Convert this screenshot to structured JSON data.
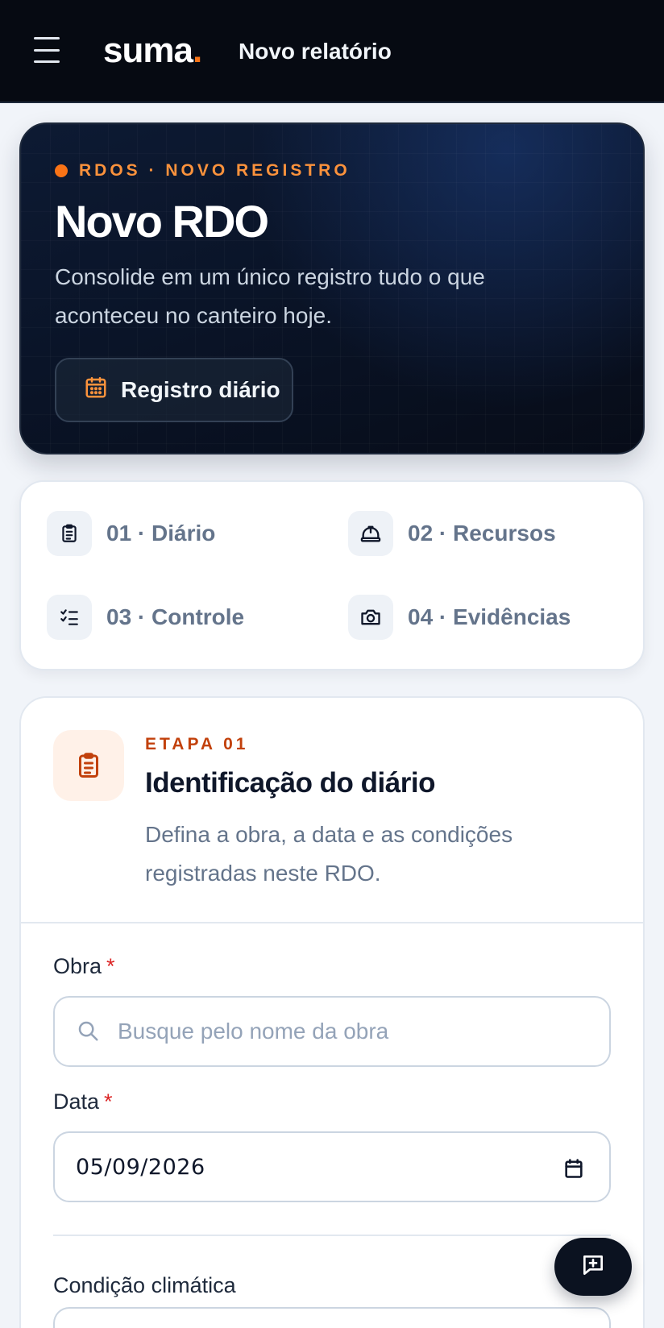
{
  "header": {
    "brand_name": "suma",
    "brand_dot": ".",
    "page_title": "Novo relatório",
    "menu_icon": "hamburger-menu-icon"
  },
  "hero": {
    "eyebrow": "RDOS · NOVO REGISTRO",
    "title": "Novo RDO",
    "description": "Consolide em um único registro tudo o que aconteceu no canteiro hoje.",
    "chip_label": "Registro diário",
    "chip_icon": "calendar-icon",
    "accent_color": "#f97316"
  },
  "steps": [
    {
      "label": "01 · Diário",
      "icon": "clipboard-icon"
    },
    {
      "label": "02 · Recursos",
      "icon": "hard-hat-icon"
    },
    {
      "label": "03 · Controle",
      "icon": "checklist-icon"
    },
    {
      "label": "04 · Evidências",
      "icon": "camera-icon"
    }
  ],
  "stage": {
    "eyebrow": "ETAPA 01",
    "title": "Identificação do diário",
    "description": "Defina a obra, a data e as condições registradas neste RDO.",
    "icon": "clipboard-icon"
  },
  "form": {
    "obra": {
      "label": "Obra",
      "required_mark": "*",
      "placeholder": "Busque pelo nome da obra",
      "value": ""
    },
    "data": {
      "label": "Data",
      "required_mark": "*",
      "value": "05/09/2026"
    },
    "clima": {
      "label": "Condição climática"
    }
  },
  "fab": {
    "icon": "message-plus-icon"
  }
}
